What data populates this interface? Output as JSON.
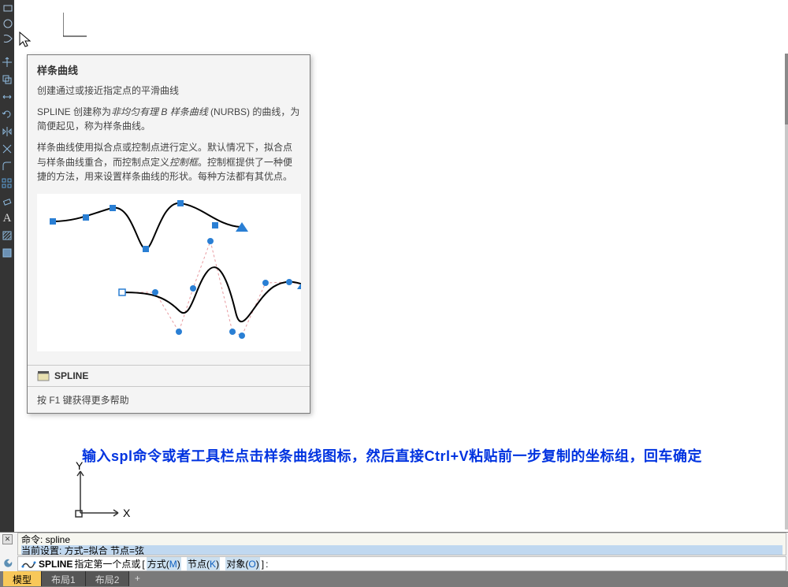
{
  "tooltip": {
    "title": "样条曲线",
    "summary": "创建通过或接近指定点的平滑曲线",
    "p1_a": "SPLINE 创建称为",
    "p1_em": "非均匀有理 B 样条曲线",
    "p1_b": " (NURBS) 的曲线，为简便起见，称为样条曲线。",
    "p2_a": "样条曲线使用拟合点或控制点进行定义。默认情况下，拟合点与样条曲线重合，而控制点定义",
    "p2_em": "控制框",
    "p2_b": "。控制框提供了一种便捷的方法，用来设置样条曲线的形状。每种方法都有其优点。",
    "command": "SPLINE",
    "f1": "按 F1 键获得更多帮助"
  },
  "instruction": "输入spl命令或者工具栏点击样条曲线图标，然后直接Ctrl+V粘贴前一步复制的坐标组，回车确定",
  "ucs": {
    "x": "X",
    "y": "Y"
  },
  "cmd": {
    "line1": "命令:  spline",
    "line2": "当前设置: 方式=拟合   节点=弦",
    "prompt_kw": "SPLINE",
    "prompt_txt": " 指定第一个点或 ",
    "opt_a_pre": "方式(",
    "opt_a_hot": "M",
    "opt_a_post": ")",
    "opt_b_pre": "节点(",
    "opt_b_hot": "K",
    "opt_b_post": ")",
    "opt_c_pre": "对象(",
    "opt_c_hot": "O",
    "opt_c_post": ")",
    "bracket_l": "[",
    "bracket_r": "]",
    "suffix": ":"
  },
  "tabs": {
    "model": "模型",
    "layout1": "布局1",
    "layout2": "布局2",
    "plus": "+"
  }
}
